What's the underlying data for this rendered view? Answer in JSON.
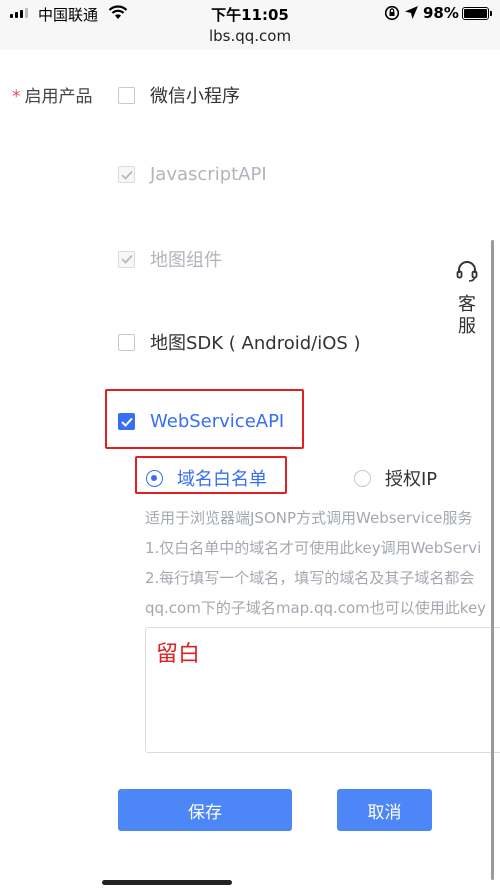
{
  "status_bar": {
    "carrier": "中国联通",
    "time": "下午11:05",
    "battery": "98%",
    "battery_level": 0.98
  },
  "browser": {
    "url": "lbs.qq.com"
  },
  "form": {
    "required_mark": "*",
    "label": "启用产品",
    "products": [
      {
        "label": "微信小程序",
        "state": "unchecked"
      },
      {
        "label": "JavascriptAPI",
        "state": "disabled-checked"
      },
      {
        "label": "地图组件",
        "state": "disabled-checked"
      },
      {
        "label": "地图SDK ( Android/iOS )",
        "state": "unchecked"
      },
      {
        "label": "WebServiceAPI",
        "state": "checked"
      }
    ],
    "auth_options": [
      {
        "label": "域名白名单",
        "selected": true
      },
      {
        "label": "授权IP",
        "selected": false
      }
    ],
    "help_lines": [
      "适用于浏览器端JSONP方式调用Webservice服务",
      "1.仅白名单中的域名才可使用此key调用WebServi",
      "2.每行填写一个域名，填写的域名及其子域名都会",
      "qq.com下的子域名map.qq.com也可以使用此key"
    ],
    "textarea_value": "留白"
  },
  "buttons": {
    "save": "保存",
    "cancel": "取消"
  },
  "service": {
    "char1": "客",
    "char2": "服"
  },
  "colors": {
    "accent": "#366ef4",
    "button": "#4d86f7",
    "highlight": "#e02020"
  }
}
